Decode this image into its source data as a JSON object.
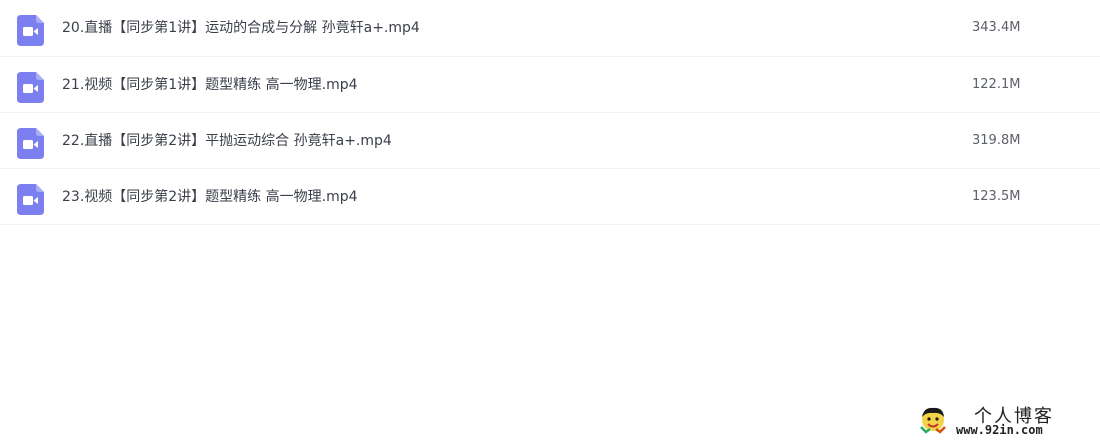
{
  "files": [
    {
      "name": "20.直播【同步第1讲】运动的合成与分解 孙竟轩a+.mp4",
      "size": "343.4M",
      "icon": "video-file-icon"
    },
    {
      "name": "21.视频【同步第1讲】题型精练 高一物理.mp4",
      "size": "122.1M",
      "icon": "video-file-icon"
    },
    {
      "name": "22.直播【同步第2讲】平抛运动综合 孙竟轩a+.mp4",
      "size": "319.8M",
      "icon": "video-file-icon"
    },
    {
      "name": "23.视频【同步第2讲】题型精练 高一物理.mp4",
      "size": "123.5M",
      "icon": "video-file-icon"
    }
  ],
  "watermark": {
    "title": "个人博客",
    "url": "www.92in.com"
  },
  "colors": {
    "icon": "#7b7ff0",
    "text": "#3b3f4a",
    "divider": "#f1f2f5"
  }
}
